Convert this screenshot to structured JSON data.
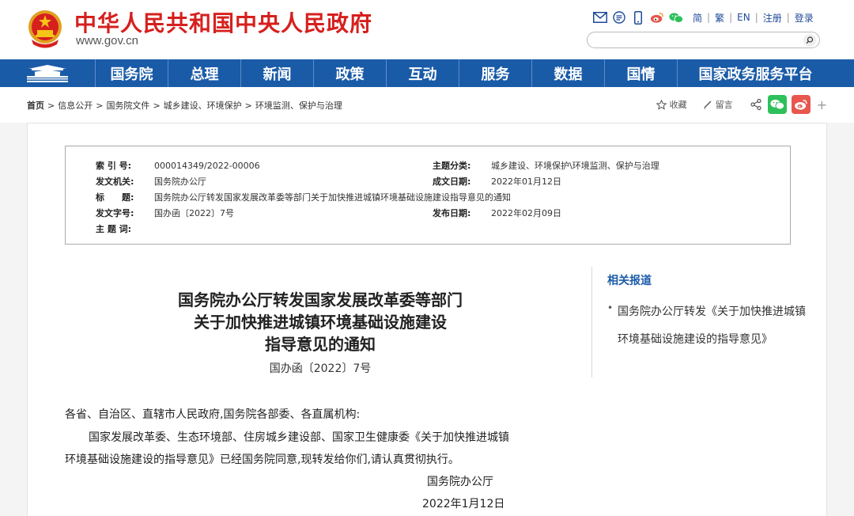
{
  "header": {
    "title": "中华人民共和国中央人民政府",
    "domain": "www.gov.cn",
    "lang_links": [
      "简",
      "繁",
      "EN",
      "注册",
      "登录"
    ],
    "search": {
      "placeholder": "",
      "value": ""
    }
  },
  "nav": {
    "items": [
      "国务院",
      "总理",
      "新闻",
      "政策",
      "互动",
      "服务",
      "数据",
      "国情",
      "国家政务服务平台"
    ]
  },
  "breadcrumb": {
    "items": [
      "首页",
      "信息公开",
      "国务院文件",
      "城乡建设、环境保护",
      "环境监测、保护与治理"
    ]
  },
  "share": {
    "favorite_label": "收藏",
    "comment_label": "留言",
    "more_label": "+"
  },
  "info": {
    "index_label": "索 引 号:",
    "index_value": "000014349/2022-00006",
    "topic_label": "主题分类:",
    "topic_value": "城乡建设、环境保护\\环境监测、保护与治理",
    "issuer_label": "发文机关:",
    "issuer_value": "国务院办公厅",
    "created_label": "成文日期:",
    "created_value": "2022年01月12日",
    "title_label": "标　　题:",
    "title_value": "国务院办公厅转发国家发展改革委等部门关于加快推进城镇环境基础设施建设指导意见的通知",
    "docno_label": "发文字号:",
    "docno_value": "国办函〔2022〕7号",
    "published_label": "发布日期:",
    "published_value": "2022年02月09日",
    "keywords_label": "主 题 词:",
    "keywords_value": ""
  },
  "article": {
    "title_lines": [
      "国务院办公厅转发国家发展改革委等部门",
      "关于加快推进城镇环境基础设施建设",
      "指导意见的通知"
    ],
    "doc_number": "国办函〔2022〕7号",
    "salutation": "各省、自治区、直辖市人民政府,国务院各部委、各直属机构:",
    "body_line1": "国家发展改革委、生态环境部、住房城乡建设部、国家卫生健康委《关于加快推进城镇",
    "body_line2": "环境基础设施建设的指导意见》已经国务院同意,现转发给你们,请认真贯彻执行。",
    "signature": "国务院办公厅",
    "date": "2022年1月12日"
  },
  "sidebar": {
    "title": "相关报道",
    "bullet": "•",
    "item": "国务院办公厅转发《关于加快推进城镇环境基础设施建设的指导意见》"
  },
  "colors": {
    "brand_red": "#d6201e",
    "nav_blue": "#1a5ba8",
    "wechat_green": "#2ec05a",
    "weibo_red": "#e8564d"
  }
}
